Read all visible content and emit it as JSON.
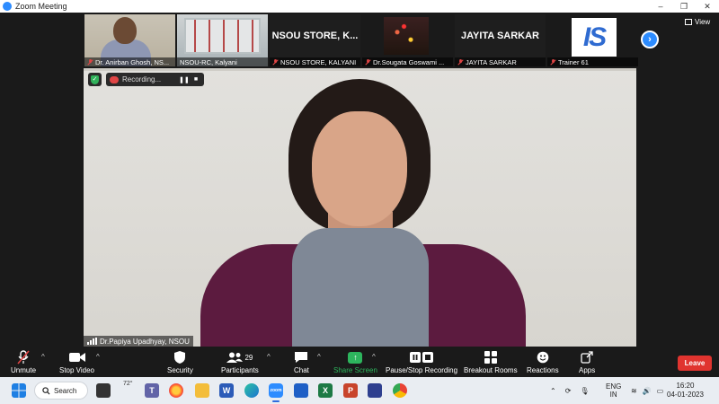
{
  "window": {
    "title": "Zoom Meeting",
    "minimize": "–",
    "maximize": "❐",
    "close": "✕"
  },
  "gallery": {
    "view_label": "View",
    "next_icon": "›",
    "tiles": [
      {
        "label": "Dr. Anirban Ghosh, NS...",
        "big_name": "",
        "muted": true
      },
      {
        "label": "NSOU-RC, Kalyani",
        "big_name": "",
        "muted": false
      },
      {
        "label": "NSOU STORE, KALYANI",
        "big_name": "NSOU STORE, K...",
        "muted": true
      },
      {
        "label": "Dr.Sougata Goswami ...",
        "big_name": "",
        "muted": true
      },
      {
        "label": "JAYITA SARKAR",
        "big_name": "JAYITA SARKAR",
        "muted": true
      },
      {
        "label": "Trainer 61",
        "big_name": "",
        "muted": true,
        "logo_text": "IS"
      }
    ]
  },
  "speaker": {
    "name": "Dr.Papiya Upadhyay, NSOU",
    "recording_label": "Recording...",
    "pause_icon": "❚❚",
    "stop_icon": "■",
    "shield_icon": "✓"
  },
  "toolbar": {
    "unmute": "Unmute",
    "stop_video": "Stop Video",
    "security": "Security",
    "participants": "Participants",
    "participants_count": "29",
    "chat": "Chat",
    "share_screen": "Share Screen",
    "pause_stop_recording": "Pause/Stop Recording",
    "breakout_rooms": "Breakout Rooms",
    "reactions": "Reactions",
    "apps": "Apps",
    "leave": "Leave",
    "caret": "^"
  },
  "taskbar": {
    "search_label": "Search",
    "weather": "72°",
    "language": "ENG",
    "region": "IN",
    "time": "16:20",
    "date": "04-01-2023",
    "icons": [
      "windows-start-icon",
      "search-icon",
      "task-view-icon",
      "weather-icon",
      "teams-chat-icon",
      "firefox-icon",
      "file-explorer-icon",
      "word-icon",
      "edge-icon",
      "zoom-icon",
      "store-icon",
      "excel-icon",
      "powerpoint-icon",
      "whiteboard-icon",
      "chrome-icon"
    ]
  },
  "colors": {
    "zoom_blue": "#2d8cff",
    "share_green": "#2db55d",
    "leave_red": "#e0342f",
    "recording_red": "#e04545"
  }
}
